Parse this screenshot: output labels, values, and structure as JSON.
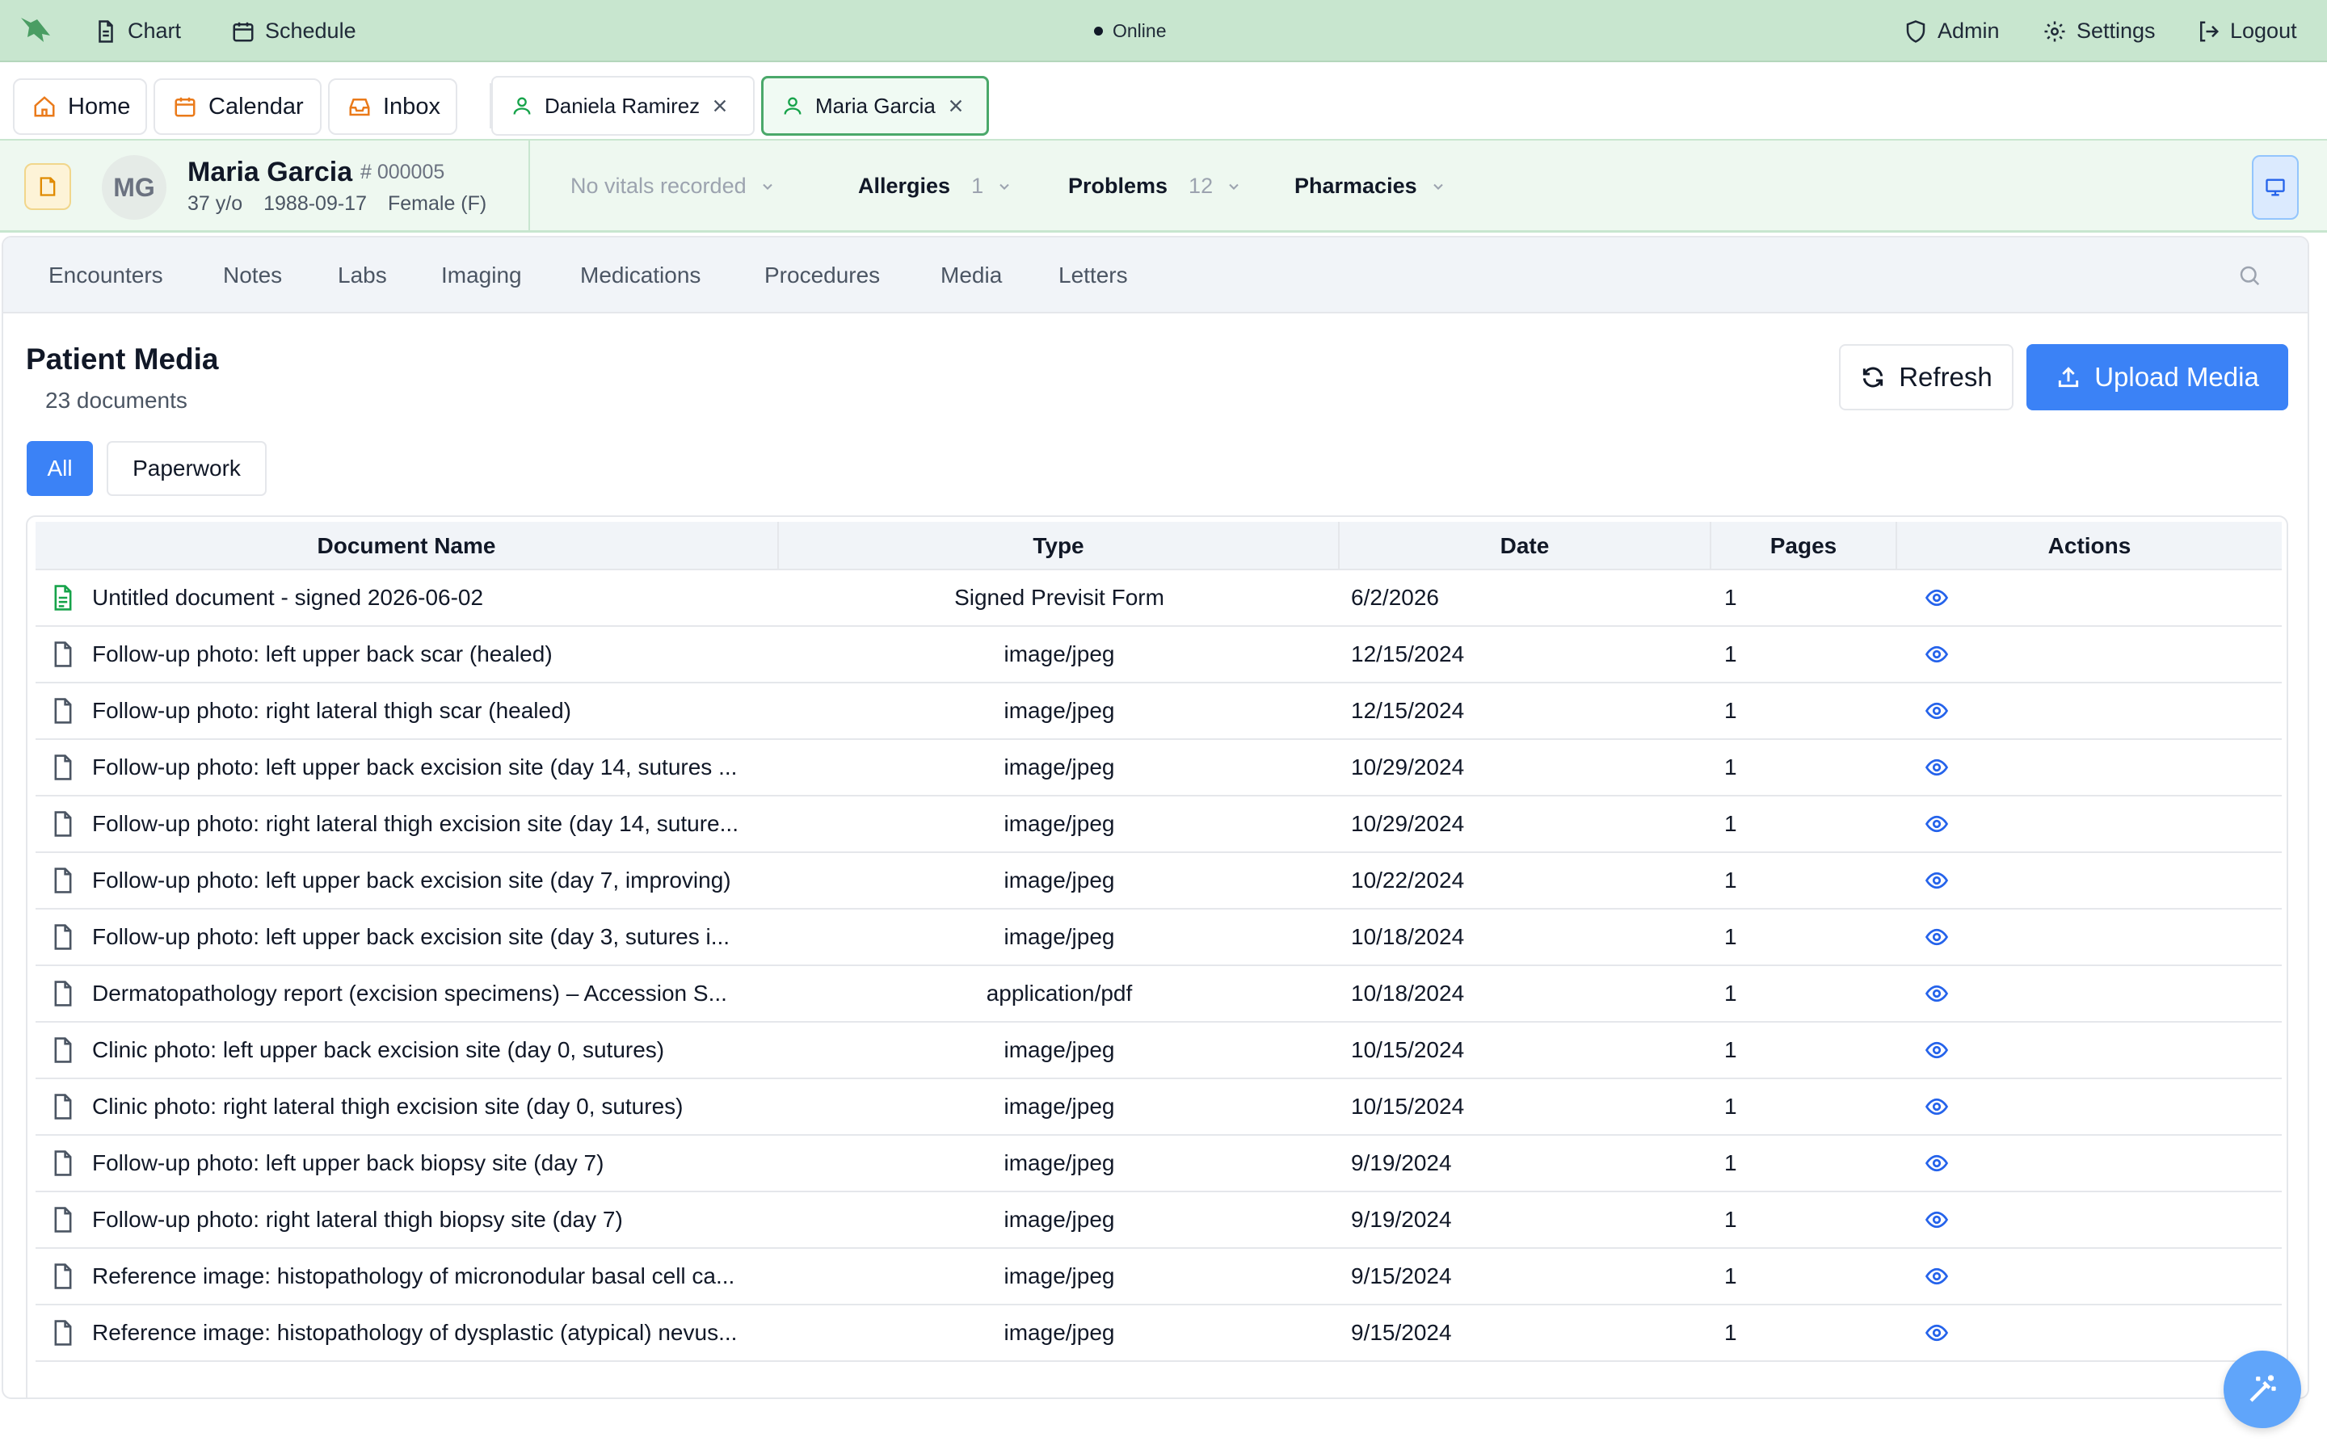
{
  "topbar": {
    "chart_label": "Chart",
    "schedule_label": "Schedule",
    "status": "Online",
    "admin_label": "Admin",
    "settings_label": "Settings",
    "logout_label": "Logout"
  },
  "app_tabs": {
    "home": "Home",
    "calendar": "Calendar",
    "inbox": "Inbox"
  },
  "patient_tabs": [
    {
      "name": "Daniela Ramirez",
      "active": false
    },
    {
      "name": "Maria Garcia",
      "active": true
    }
  ],
  "patient": {
    "initials": "MG",
    "name": "Maria Garcia",
    "id": "# 000005",
    "age": "37 y/o",
    "dob": "1988-09-17",
    "sex": "Female (F)"
  },
  "header_dropdowns": {
    "vitals": "No vitals recorded",
    "allergies_label": "Allergies",
    "allergies_count": "1",
    "problems_label": "Problems",
    "problems_count": "12",
    "pharmacies_label": "Pharmacies"
  },
  "subnav": [
    "Encounters",
    "Notes",
    "Labs",
    "Imaging",
    "Medications",
    "Procedures",
    "Media",
    "Letters"
  ],
  "media": {
    "title": "Patient Media",
    "count": "23 documents",
    "refresh_label": "Refresh",
    "upload_label": "Upload Media",
    "filters": [
      "All",
      "Paperwork"
    ]
  },
  "table": {
    "headers": [
      "Document Name",
      "Type",
      "Date",
      "Pages",
      "Actions"
    ],
    "rows": [
      {
        "name": "Untitled document - signed 2026-06-02",
        "type": "Signed Previsit Form",
        "date": "6/2/2026",
        "pages": "1",
        "icon": "signed-document-icon"
      },
      {
        "name": "Follow-up photo: left upper back scar (healed)",
        "type": "image/jpeg",
        "date": "12/15/2024",
        "pages": "1",
        "icon": "file-icon"
      },
      {
        "name": "Follow-up photo: right lateral thigh scar (healed)",
        "type": "image/jpeg",
        "date": "12/15/2024",
        "pages": "1",
        "icon": "file-icon"
      },
      {
        "name": "Follow-up photo: left upper back excision site (day 14, sutures ...",
        "type": "image/jpeg",
        "date": "10/29/2024",
        "pages": "1",
        "icon": "file-icon"
      },
      {
        "name": "Follow-up photo: right lateral thigh excision site (day 14, suture...",
        "type": "image/jpeg",
        "date": "10/29/2024",
        "pages": "1",
        "icon": "file-icon"
      },
      {
        "name": "Follow-up photo: left upper back excision site (day 7, improving)",
        "type": "image/jpeg",
        "date": "10/22/2024",
        "pages": "1",
        "icon": "file-icon"
      },
      {
        "name": "Follow-up photo: left upper back excision site (day 3, sutures i...",
        "type": "image/jpeg",
        "date": "10/18/2024",
        "pages": "1",
        "icon": "file-icon"
      },
      {
        "name": "Dermatopathology report (excision specimens) – Accession S...",
        "type": "application/pdf",
        "date": "10/18/2024",
        "pages": "1",
        "icon": "file-icon"
      },
      {
        "name": "Clinic photo: left upper back excision site (day 0, sutures)",
        "type": "image/jpeg",
        "date": "10/15/2024",
        "pages": "1",
        "icon": "file-icon"
      },
      {
        "name": "Clinic photo: right lateral thigh excision site (day 0, sutures)",
        "type": "image/jpeg",
        "date": "10/15/2024",
        "pages": "1",
        "icon": "file-icon"
      },
      {
        "name": "Follow-up photo: left upper back biopsy site (day 7)",
        "type": "image/jpeg",
        "date": "9/19/2024",
        "pages": "1",
        "icon": "file-icon"
      },
      {
        "name": "Follow-up photo: right lateral thigh biopsy site (day 7)",
        "type": "image/jpeg",
        "date": "9/19/2024",
        "pages": "1",
        "icon": "file-icon"
      },
      {
        "name": "Reference image: histopathology of micronodular basal cell ca...",
        "type": "image/jpeg",
        "date": "9/15/2024",
        "pages": "1",
        "icon": "file-icon"
      },
      {
        "name": "Reference image: histopathology of dysplastic (atypical) nevus...",
        "type": "image/jpeg",
        "date": "9/15/2024",
        "pages": "1",
        "icon": "file-icon"
      }
    ]
  },
  "colors": {
    "topbar_bg": "#c8e6cf",
    "accent_blue": "#3b82f6",
    "active_tab_border": "#4aa86a",
    "signed_icon": "#16a34a"
  }
}
